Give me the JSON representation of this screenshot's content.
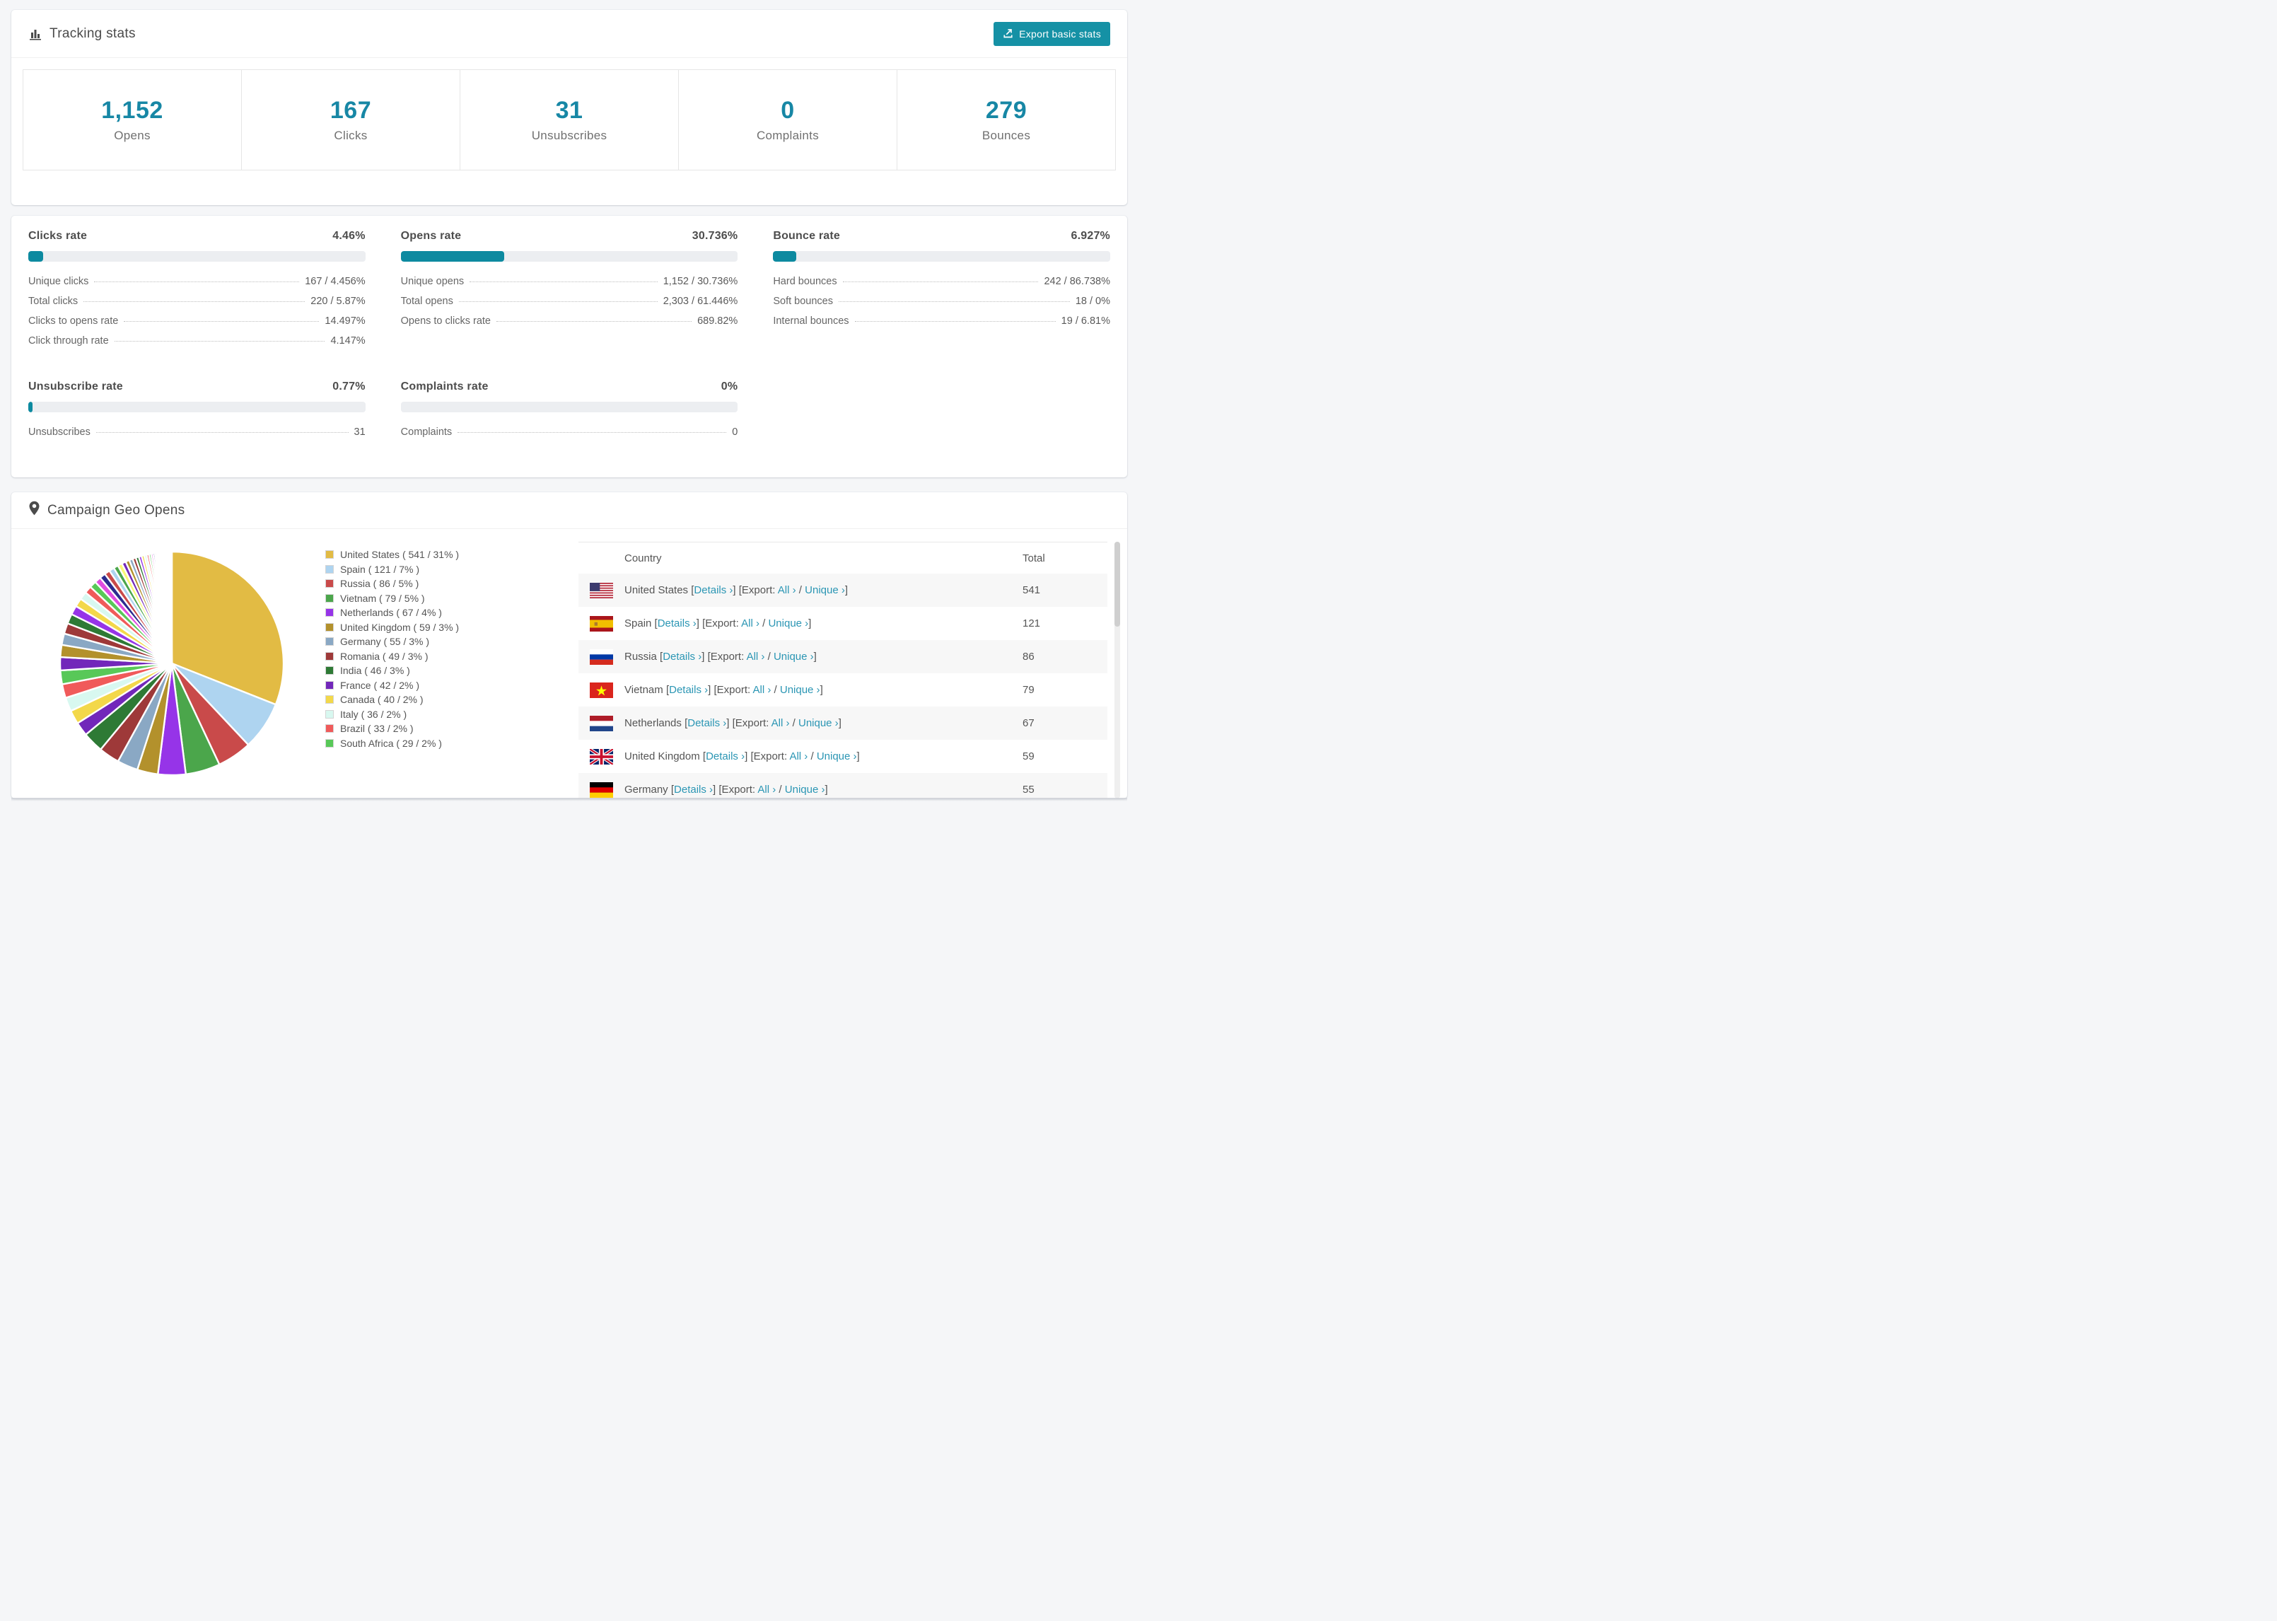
{
  "colors": {
    "accent_text": "#1787a5",
    "bar_fill": "#0d8aa0",
    "button_bg": "#1591a5",
    "link": "#2b96b4",
    "track": "#eceef1"
  },
  "tracking": {
    "title": "Tracking stats",
    "export_button_label": "Export basic stats",
    "summary": [
      {
        "value": "1,152",
        "label": "Opens"
      },
      {
        "value": "167",
        "label": "Clicks"
      },
      {
        "value": "31",
        "label": "Unsubscribes"
      },
      {
        "value": "0",
        "label": "Complaints"
      },
      {
        "value": "279",
        "label": "Bounces"
      }
    ]
  },
  "rates": [
    {
      "title": "Clicks rate",
      "value": "4.46%",
      "percent": 4.46,
      "rows": [
        {
          "label": "Unique clicks",
          "value": "167 / 4.456%"
        },
        {
          "label": "Total clicks",
          "value": "220 / 5.87%"
        },
        {
          "label": "Clicks to opens rate",
          "value": "14.497%"
        },
        {
          "label": "Click through rate",
          "value": "4.147%"
        }
      ]
    },
    {
      "title": "Opens rate",
      "value": "30.736%",
      "percent": 30.736,
      "rows": [
        {
          "label": "Unique opens",
          "value": "1,152 / 30.736%"
        },
        {
          "label": "Total opens",
          "value": "2,303 / 61.446%"
        },
        {
          "label": "Opens to clicks rate",
          "value": "689.82%"
        }
      ]
    },
    {
      "title": "Bounce rate",
      "value": "6.927%",
      "percent": 6.927,
      "rows": [
        {
          "label": "Hard bounces",
          "value": "242 / 86.738%"
        },
        {
          "label": "Soft bounces",
          "value": "18 / 0%"
        },
        {
          "label": "Internal bounces",
          "value": "19 / 6.81%"
        }
      ]
    },
    {
      "title": "Unsubscribe rate",
      "value": "0.77%",
      "percent": 0.77,
      "rows": [
        {
          "label": "Unsubscribes",
          "value": "31"
        }
      ]
    },
    {
      "title": "Complaints rate",
      "value": "0%",
      "percent": 0,
      "rows": [
        {
          "label": "Complaints",
          "value": "0"
        }
      ]
    }
  ],
  "geo": {
    "title": "Campaign Geo Opens",
    "legend": [
      {
        "name": "United States",
        "count": "541",
        "pct": "31",
        "color": "#e2bb44"
      },
      {
        "name": "Spain",
        "count": "121",
        "pct": "7",
        "color": "#aed4f0"
      },
      {
        "name": "Russia",
        "count": "86",
        "pct": "5",
        "color": "#c94a4a"
      },
      {
        "name": "Vietnam",
        "count": "79",
        "pct": "5",
        "color": "#4ba64b"
      },
      {
        "name": "Netherlands",
        "count": "67",
        "pct": "4",
        "color": "#9634e8"
      },
      {
        "name": "United Kingdom",
        "count": "59",
        "pct": "3",
        "color": "#b3912c"
      },
      {
        "name": "Germany",
        "count": "55",
        "pct": "3",
        "color": "#8aa8c4"
      },
      {
        "name": "Romania",
        "count": "49",
        "pct": "3",
        "color": "#9e3939"
      },
      {
        "name": "India",
        "count": "46",
        "pct": "3",
        "color": "#2e7a35"
      },
      {
        "name": "France",
        "count": "42",
        "pct": "2",
        "color": "#7227ba"
      },
      {
        "name": "Canada",
        "count": "40",
        "pct": "2",
        "color": "#f3d84a"
      },
      {
        "name": "Italy",
        "count": "36",
        "pct": "2",
        "color": "#d8f8f0"
      },
      {
        "name": "Brazil",
        "count": "33",
        "pct": "2",
        "color": "#f05a5a"
      },
      {
        "name": "South Africa",
        "count": "29",
        "pct": "2",
        "color": "#58c858"
      }
    ],
    "table": {
      "headers": [
        "Country",
        "Total"
      ],
      "link_labels": {
        "details": "Details",
        "export_prefix": "Export:",
        "all": "All",
        "unique": "Unique",
        "chevron": "›"
      },
      "rows": [
        {
          "country": "United States",
          "flag": "us",
          "total": "541"
        },
        {
          "country": "Spain",
          "flag": "es",
          "total": "121"
        },
        {
          "country": "Russia",
          "flag": "ru",
          "total": "86"
        },
        {
          "country": "Vietnam",
          "flag": "vn",
          "total": "79"
        },
        {
          "country": "Netherlands",
          "flag": "nl",
          "total": "67"
        },
        {
          "country": "United Kingdom",
          "flag": "gb",
          "total": "59"
        },
        {
          "country": "Germany",
          "flag": "de",
          "total": "55"
        }
      ]
    }
  },
  "chart_data": {
    "type": "pie",
    "title": "Campaign Geo Opens",
    "legend_position": "right",
    "start_angle_deg": -90,
    "direction": "clockwise",
    "series": [
      {
        "name": "United States",
        "value": 541,
        "pct": 31,
        "color": "#e2bb44"
      },
      {
        "name": "Spain",
        "value": 121,
        "pct": 7,
        "color": "#aed4f0"
      },
      {
        "name": "Russia",
        "value": 86,
        "pct": 5,
        "color": "#c94a4a"
      },
      {
        "name": "Vietnam",
        "value": 79,
        "pct": 5,
        "color": "#4ba64b"
      },
      {
        "name": "Netherlands",
        "value": 67,
        "pct": 4,
        "color": "#9634e8"
      },
      {
        "name": "United Kingdom",
        "value": 59,
        "pct": 3,
        "color": "#b3912c"
      },
      {
        "name": "Germany",
        "value": 55,
        "pct": 3,
        "color": "#8aa8c4"
      },
      {
        "name": "Romania",
        "value": 49,
        "pct": 3,
        "color": "#9e3939"
      },
      {
        "name": "India",
        "value": 46,
        "pct": 3,
        "color": "#2e7a35"
      },
      {
        "name": "France",
        "value": 42,
        "pct": 2,
        "color": "#7227ba"
      },
      {
        "name": "Canada",
        "value": 40,
        "pct": 2,
        "color": "#f3d84a"
      },
      {
        "name": "Italy",
        "value": 36,
        "pct": 2,
        "color": "#d8f8f0"
      },
      {
        "name": "Brazil",
        "value": 33,
        "pct": 2,
        "color": "#f05a5a"
      },
      {
        "name": "South Africa",
        "value": 29,
        "pct": 2,
        "color": "#58c858"
      }
    ],
    "others": {
      "total_pct": 26,
      "slice_count": 44,
      "decay": 0.93
    }
  }
}
